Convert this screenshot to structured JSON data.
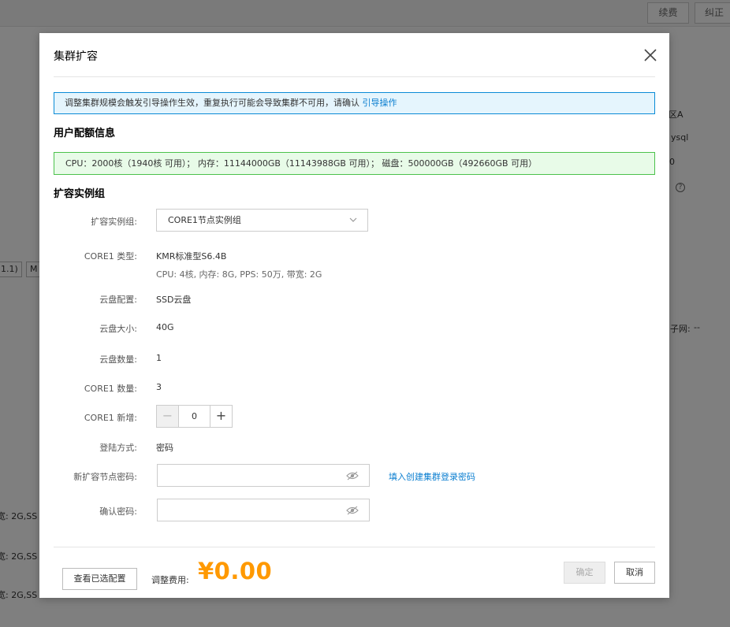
{
  "background": {
    "top_buttons": [
      "续费",
      "纠正"
    ],
    "side_texts": [
      "区A",
      "ysql",
      "0",
      "子网:",
      "--"
    ],
    "left_tags": [
      "1.1)",
      "M"
    ],
    "bottom_texts": [
      "宽: 2G,SS",
      "宽: 2G,SS",
      "宽: 2G,SS"
    ]
  },
  "modal": {
    "title": "集群扩容",
    "notice_text": "调整集群规模会触发引导操作生效，重复执行可能会导致集群不可用，请确认",
    "notice_link": "引导操作",
    "quota_title": "用户配额信息",
    "quota_text": "CPU：2000核（1940核 可用）；  内存：11144000GB（11143988GB 可用）；  磁盘：500000GB（492660GB 可用）",
    "group_title": "扩容实例组",
    "fields": {
      "group_label": "扩容实例组:",
      "group_value": "CORE1节点实例组",
      "type_label": "CORE1 类型:",
      "type_value": "KMR标准型S6.4B",
      "type_spec": "CPU: 4核, 内存: 8G, PPS: 50万, 带宽: 2G",
      "disk_conf_label": "云盘配置:",
      "disk_conf_value": "SSD云盘",
      "disk_size_label": "云盘大小:",
      "disk_size_value": "40G",
      "disk_count_label": "云盘数量:",
      "disk_count_value": "1",
      "core_count_label": "CORE1 数量:",
      "core_count_value": "3",
      "core_add_label": "CORE1 新增:",
      "core_add_value": "0",
      "login_label": "登陆方式:",
      "login_value": "密码",
      "new_pwd_label": "新扩容节点密码:",
      "new_pwd_value": "",
      "fill_pwd_link": "填入创建集群登录密码",
      "confirm_pwd_label": "确认密码:",
      "confirm_pwd_value": ""
    },
    "footer": {
      "view_button": "查看已选配置",
      "fee_label": "调整费用:",
      "fee_value": "¥0.00",
      "confirm_button": "确定",
      "cancel_button": "取消"
    }
  },
  "colors": {
    "accent_link": "#0a7ed0",
    "price": "#ff9900",
    "info_border": "#0a8bd6",
    "success_border": "#4cc24c"
  },
  "icons": {
    "close": "close-icon",
    "dropdown": "chevron-down-icon",
    "password_visibility": "eye-off-icon"
  }
}
